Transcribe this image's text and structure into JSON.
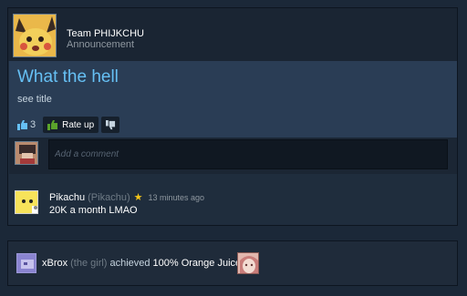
{
  "announcement": {
    "team_name": "Team PHIJKCHU",
    "role": "Announcement",
    "title": "What the hell",
    "body": "see title",
    "upvotes": "3",
    "rate_up_label": "Rate up"
  },
  "comment_box": {
    "placeholder": "Add a comment"
  },
  "comments": [
    {
      "author": "Pikachu",
      "alias": "(Pikachu)",
      "time": "13 minutes ago",
      "text": "20K a month LMAO"
    }
  ],
  "activity": {
    "user": "xBrox",
    "alias": "(the girl)",
    "verb": "achieved",
    "achievement": "100% Orange Juice"
  },
  "colors": {
    "title": "#66c0f4",
    "background": "#1b2838",
    "star": "#f5c518",
    "rate_icon": "#5ba32b"
  }
}
